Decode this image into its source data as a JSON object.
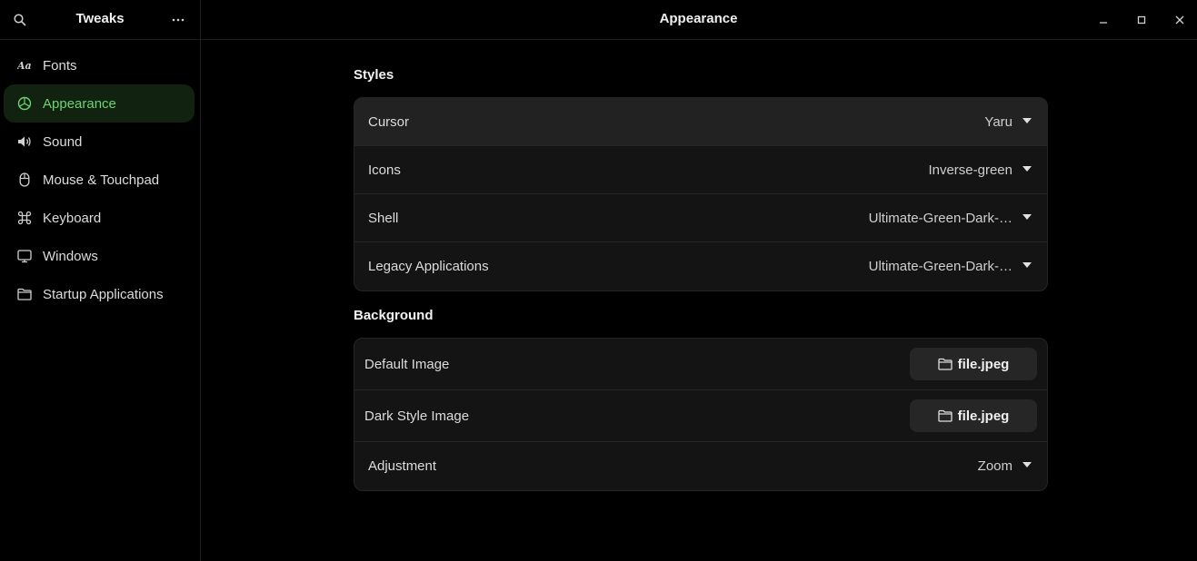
{
  "header": {
    "left_title": "Tweaks",
    "title": "Appearance",
    "icons": {
      "search": "search-icon",
      "menu": "more-icon",
      "minimize": "minimize-icon",
      "maximize": "maximize-icon",
      "close": "close-icon"
    }
  },
  "sidebar": {
    "items": [
      {
        "label": "Fonts",
        "icon": "fonts-icon"
      },
      {
        "label": "Appearance",
        "icon": "appearance-icon",
        "active": true
      },
      {
        "label": "Sound",
        "icon": "sound-icon"
      },
      {
        "label": "Mouse & Touchpad",
        "icon": "mouse-icon"
      },
      {
        "label": "Keyboard",
        "icon": "keyboard-icon"
      },
      {
        "label": "Windows",
        "icon": "windows-icon"
      },
      {
        "label": "Startup Applications",
        "icon": "folder-icon"
      }
    ]
  },
  "styles": {
    "title": "Styles",
    "rows": [
      {
        "label": "Cursor",
        "value": "Yaru"
      },
      {
        "label": "Icons",
        "value": "Inverse-green"
      },
      {
        "label": "Shell",
        "value": "Ultimate-Green-Dark-…"
      },
      {
        "label": "Legacy Applications",
        "value": "Ultimate-Green-Dark-…"
      }
    ]
  },
  "background": {
    "title": "Background",
    "default_image": {
      "label": "Default Image",
      "file": "file.jpeg"
    },
    "dark_image": {
      "label": "Dark Style Image",
      "file": "file.jpeg"
    },
    "adjustment": {
      "label": "Adjustment",
      "value": "Zoom"
    }
  },
  "colors": {
    "accent": "#6fd46f",
    "active_bg": "#112211",
    "background": "#000000",
    "card": "#141414"
  }
}
